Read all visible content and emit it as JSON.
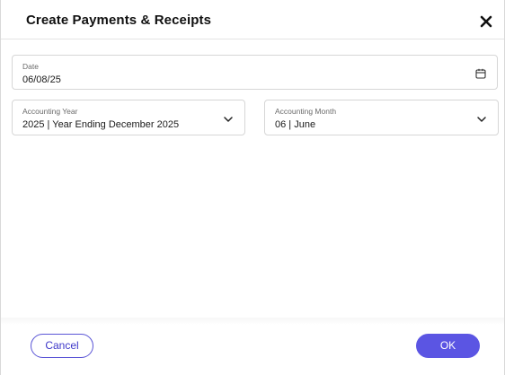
{
  "dialog": {
    "title": "Create Payments & Receipts",
    "close_icon": "close-icon"
  },
  "fields": {
    "date": {
      "label": "Date",
      "value": "06/08/25",
      "icon": "calendar-icon"
    },
    "accounting_year": {
      "label": "Accounting Year",
      "value": "2025 | Year Ending December 2025",
      "icon": "chevron-down-icon"
    },
    "accounting_month": {
      "label": "Accounting Month",
      "value": "06 | June",
      "icon": "chevron-down-icon"
    }
  },
  "footer": {
    "cancel_label": "Cancel",
    "ok_label": "OK"
  },
  "colors": {
    "accent": "#5b55e3",
    "accent_outline": "#5a55d6",
    "border": "#d6d6d6"
  }
}
